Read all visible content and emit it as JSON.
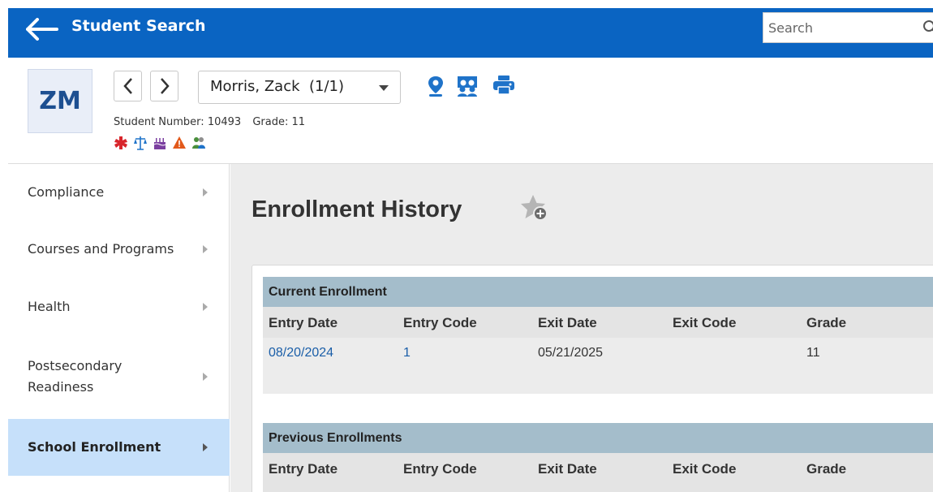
{
  "topbar": {
    "title": "Student Search",
    "search_placeholder": "Search",
    "accent": "#0a64c2"
  },
  "student": {
    "initials": "ZM",
    "name": "Morris, Zack  (1/1)",
    "student_number_label": "Student Number: 10493",
    "grade_label": "Grade: 11",
    "header_icons": [
      "map-pin-icon",
      "people-icon",
      "print-icon"
    ],
    "alert_icons": [
      "medical-alert-icon",
      "legal-scale-icon",
      "birthday-icon",
      "warning-icon",
      "group-icon"
    ]
  },
  "sidebar": {
    "items": [
      {
        "label": "Compliance"
      },
      {
        "label": "Courses and Programs"
      },
      {
        "label": "Health"
      },
      {
        "label": "Postsecondary Readiness"
      },
      {
        "label": "School Enrollment",
        "active": true
      }
    ]
  },
  "main": {
    "title": "Enrollment History",
    "current": {
      "heading": "Current Enrollment",
      "columns": [
        "Entry Date",
        "Entry Code",
        "Exit Date",
        "Exit Code",
        "Grade"
      ],
      "rows": [
        {
          "entry_date": "08/20/2024",
          "entry_code": "1",
          "exit_date": "05/21/2025",
          "exit_code": "",
          "grade": "11"
        }
      ]
    },
    "previous": {
      "heading": "Previous Enrollments",
      "columns": [
        "Entry Date",
        "Entry Code",
        "Exit Date",
        "Exit Code",
        "Grade"
      ]
    }
  }
}
